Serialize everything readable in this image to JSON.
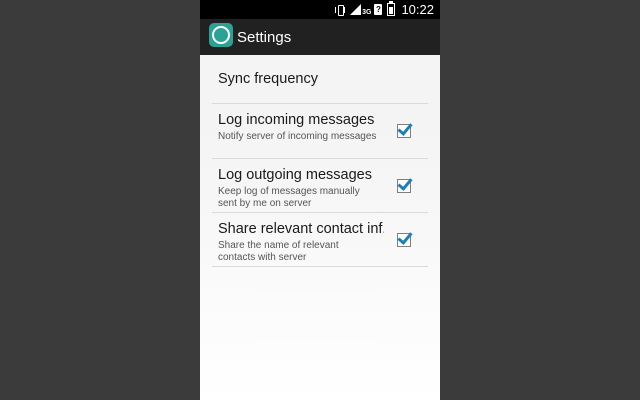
{
  "status_bar": {
    "network": "3G",
    "time": "10:22"
  },
  "action_bar": {
    "title": "Settings"
  },
  "preferences": {
    "sync_frequency": {
      "title": "Sync frequency"
    },
    "log_incoming": {
      "title": "Log incoming messages",
      "summary": "Notify server of incoming messages",
      "checked": true
    },
    "log_outgoing": {
      "title": "Log outgoing messages",
      "summary": "Keep log of messages manually sent by me on server",
      "checked": true
    },
    "share_contact": {
      "title": "Share relevant contact inf..",
      "summary": "Share the name of relevant contacts with server",
      "checked": true
    }
  },
  "colors": {
    "accent": "#1d7fb5",
    "app_icon": "#2aa396",
    "action_bar": "#212121"
  }
}
